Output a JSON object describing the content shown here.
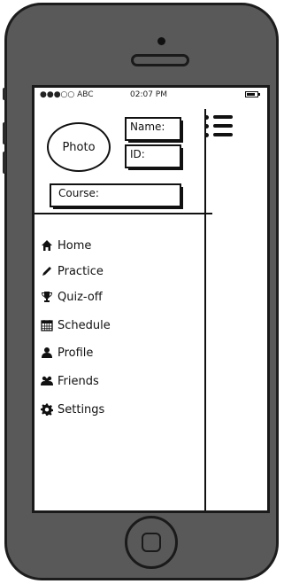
{
  "status": {
    "carrier": "●●●○○ ABC",
    "time": "02:07 PM"
  },
  "profile": {
    "photo_label": "Photo",
    "name_label": "Name:",
    "id_label": "ID:",
    "course_label": "Course:"
  },
  "menu": [
    {
      "label": "Home",
      "icon": "home-icon"
    },
    {
      "label": "Practice",
      "icon": "pencil-icon"
    },
    {
      "label": "Quiz-off",
      "icon": "trophy-icon"
    },
    {
      "label": "Schedule",
      "icon": "calendar-icon"
    },
    {
      "label": "Profile",
      "icon": "user-icon"
    },
    {
      "label": "Friends",
      "icon": "users-icon"
    },
    {
      "label": "Settings",
      "icon": "gear-icon"
    }
  ],
  "toolbar": {
    "menu_icon": "hamburger-icon"
  }
}
